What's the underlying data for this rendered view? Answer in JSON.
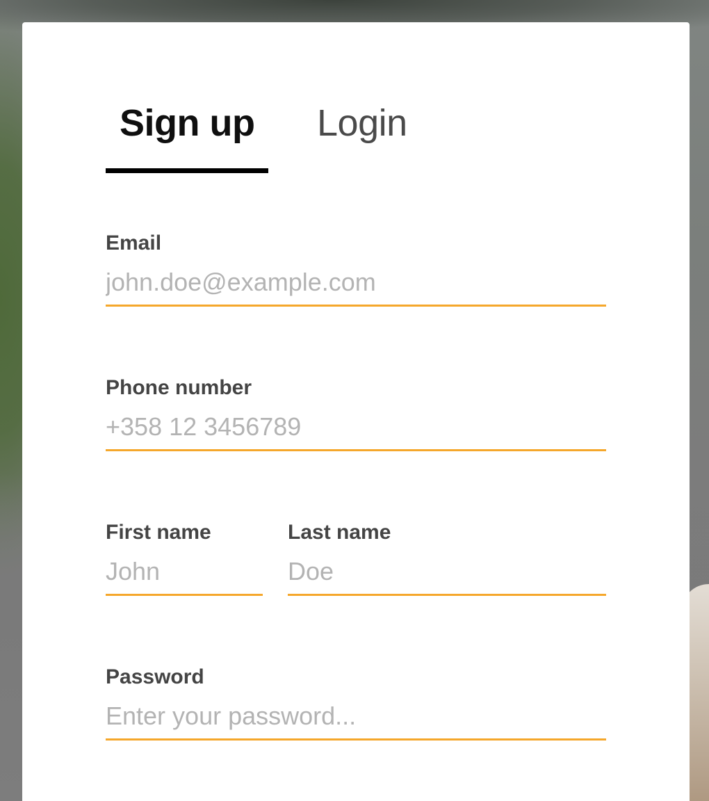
{
  "tabs": {
    "signup_label": "Sign up",
    "login_label": "Login",
    "active": "signup"
  },
  "form": {
    "email": {
      "label": "Email",
      "placeholder": "john.doe@example.com"
    },
    "phone": {
      "label": "Phone number",
      "placeholder": "+358 12 3456789"
    },
    "first_name": {
      "label": "First name",
      "placeholder": "John"
    },
    "last_name": {
      "label": "Last name",
      "placeholder": "Doe"
    },
    "password": {
      "label": "Password",
      "placeholder": "Enter your password..."
    }
  },
  "colors": {
    "accent": "#f5a72b",
    "active_tab": "#0f0f0f",
    "inactive_tab": "#4a4a4a",
    "label": "#444444",
    "placeholder": "#b3b3b3",
    "card": "#ffffff"
  }
}
